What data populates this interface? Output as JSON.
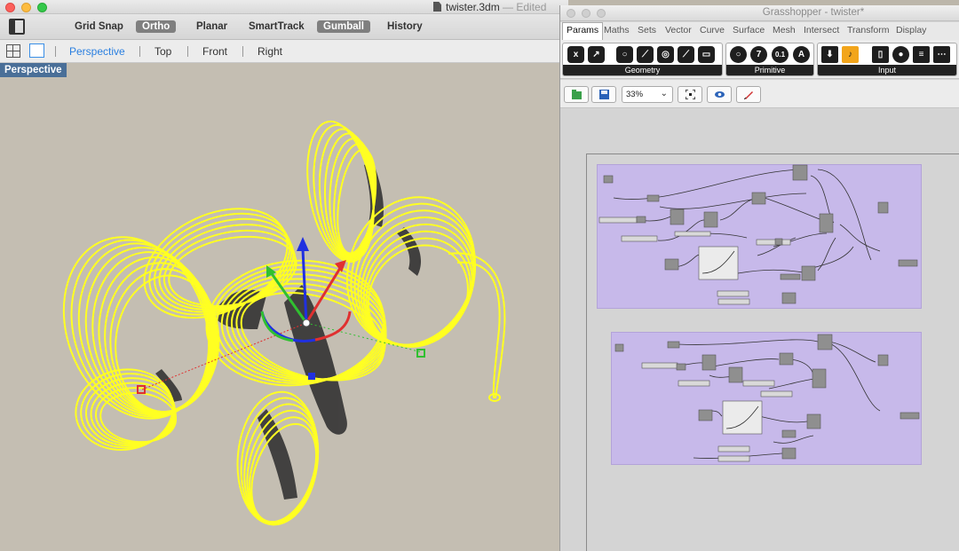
{
  "rhino": {
    "document_name": "twister.3dm",
    "document_status": "— Edited",
    "osnap_items": [
      {
        "label": "Grid Snap",
        "on": false
      },
      {
        "label": "Ortho",
        "on": true
      },
      {
        "label": "Planar",
        "on": false
      },
      {
        "label": "SmartTrack",
        "on": false
      },
      {
        "label": "Gumball",
        "on": true
      },
      {
        "label": "History",
        "on": false
      }
    ],
    "viewport_tabs": [
      "Perspective",
      "Top",
      "Front",
      "Right"
    ],
    "active_viewport": "Perspective",
    "viewport_label": "Perspective",
    "colors": {
      "curve_selected": "#ffff22",
      "viewport_bg": "#c4beb2",
      "viewport_label_bg": "#4a6f98",
      "active_tab": "#2a7fe0"
    }
  },
  "grasshopper": {
    "window_title": "Grasshopper - twister*",
    "tabs": [
      "Params",
      "Maths",
      "Sets",
      "Vector",
      "Curve",
      "Surface",
      "Mesh",
      "Intersect",
      "Transform",
      "Display"
    ],
    "active_tab": "Params",
    "ribbon_groups": [
      {
        "label": "Geometry",
        "icons": [
          "x",
          "↗",
          "○",
          "⟋",
          "◎",
          "⟋",
          "▭"
        ]
      },
      {
        "label": "Primitive",
        "icons": [
          "○",
          "7",
          "0.1",
          "A"
        ]
      },
      {
        "label": "Input",
        "icons": [
          "⬇",
          "♪",
          "▯",
          "●",
          "≡",
          "⋯"
        ]
      }
    ],
    "zoom": "33%",
    "colors": {
      "cluster_bg": "#c7b9ea",
      "canvas_bg": "#d4d4d4"
    }
  }
}
